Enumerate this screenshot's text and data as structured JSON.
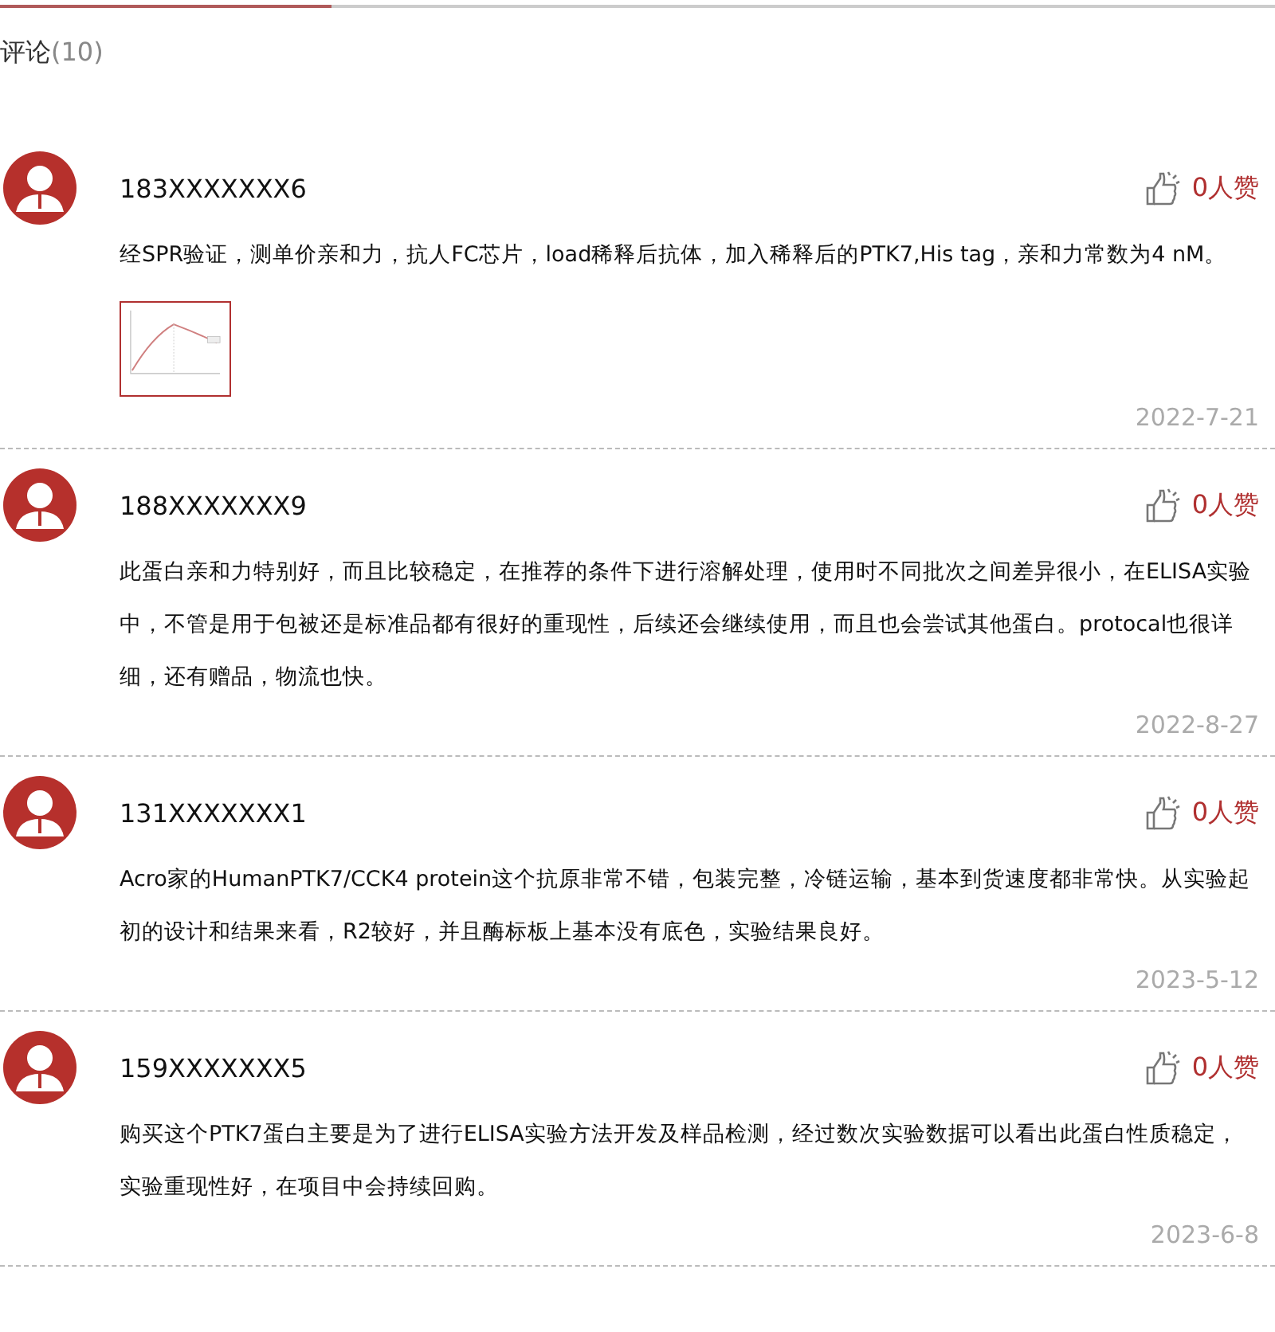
{
  "tab_bar": {
    "level": 0.26
  },
  "header": {
    "title": "评论",
    "count": "(10)"
  },
  "comments": [
    {
      "user": "183XXXXXXX6",
      "likes": "0人赞",
      "text": "经SPR验证，测单价亲和力，抗人FC芯片，load稀释后抗体，加入稀释后的PTK7,His tag，亲和力常数为4 nM。",
      "date": "2022-7-21"
    },
    {
      "user": "188XXXXXXX9",
      "likes": "0人赞",
      "text": "此蛋白亲和力特别好，而且比较稳定，在推荐的条件下进行溶解处理，使用时不同批次之间差异很小，在ELISA实验中，不管是用于包被还是标准品都有很好的重现性，后续还会继续使用，而且也会尝试其他蛋白。protocal也很详细，还有赠品，物流也快。",
      "date": "2022-8-27"
    },
    {
      "user": "131XXXXXXX1",
      "likes": "0人赞",
      "text": "Acro家的HumanPTK7/CCK4 protein这个抗原非常不错，包装完整，冷链运输，基本到货速度都非常快。从实验起初的设计和结果来看，R2较好，并且酶标板上基本没有底色，实验结果良好。",
      "date": "2023-5-12"
    },
    {
      "user": "159XXXXXXX5",
      "likes": "0人赞",
      "text": "购买这个PTK7蛋白主要是为了进行ELISA实验方法开发及样品检测，经过数次实验数据可以看出此蛋白性质稳定，实验重现性好，在项目中会持续回购。",
      "date": "2023-6-8"
    }
  ]
}
